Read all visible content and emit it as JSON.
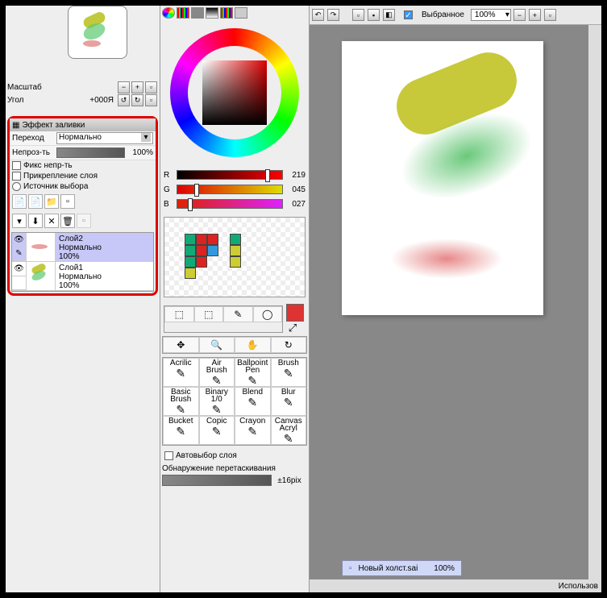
{
  "navigator": {
    "scale_label": "Масштаб",
    "angle_label": "Угол",
    "angle_value": "+000Я"
  },
  "fill_effect": {
    "title": "Эффект заливки",
    "blend_label": "Переход",
    "blend_value": "Нормально",
    "opacity_label": "Непроз-ть",
    "opacity_value": "100%",
    "lock_opacity": "Фикс непр-ть",
    "clip_layer": "Прикрепление слоя",
    "selection_source": "Источник выбора"
  },
  "layers": [
    {
      "name": "Слой2",
      "mode": "Нормально",
      "opacity": "100%",
      "active": true,
      "stroke": "red"
    },
    {
      "name": "Слой1",
      "mode": "Нормально",
      "opacity": "100%",
      "active": false,
      "stroke": "mix"
    }
  ],
  "rgb": {
    "r_label": "R",
    "g_label": "G",
    "b_label": "B",
    "r": "219",
    "g": "045",
    "b": "027"
  },
  "swatch_colors": [
    "#1a7",
    "#d22",
    "#d22",
    "",
    "#1a7",
    "#1a7",
    "#d22",
    "#39d",
    "",
    "#cc3",
    "#1a7",
    "#d22",
    "",
    "",
    "#cc3",
    "#cc3",
    "",
    "",
    "",
    ""
  ],
  "tools_row1": [
    "⬚",
    "⬚",
    "✎",
    "◯"
  ],
  "tools_row2": [
    "✥",
    "🔍",
    "✋",
    "↻"
  ],
  "brushes": [
    {
      "n": "Acrilic"
    },
    {
      "n": "Air Brush"
    },
    {
      "n": "Ballpoint Pen"
    },
    {
      "n": "Brush"
    },
    {
      "n": "Basic Brush"
    },
    {
      "n": "Binary 1/0"
    },
    {
      "n": "Blend"
    },
    {
      "n": "Blur"
    },
    {
      "n": "Bucket"
    },
    {
      "n": "Copic"
    },
    {
      "n": "Crayon"
    },
    {
      "n": "Canvas Acryl"
    }
  ],
  "auto_select": "Автовыбор слоя",
  "drag_detect": "Обнаружение перетаскивания",
  "drag_val": "±16pix",
  "toolbar": {
    "selected_label": "Выбранное",
    "zoom": "100%"
  },
  "document": {
    "name": "Новый холст.sai",
    "zoom": "100%"
  },
  "status": "Использов"
}
